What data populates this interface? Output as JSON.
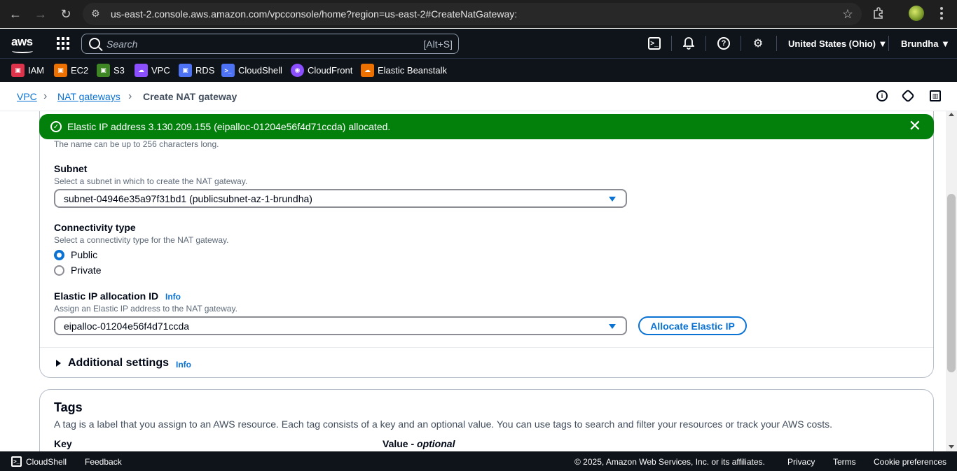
{
  "browser": {
    "url": "us-east-2.console.aws.amazon.com/vpcconsole/home?region=us-east-2#CreateNatGateway:"
  },
  "topnav": {
    "logo": "aws",
    "search_placeholder": "Search",
    "search_shortcut": "[Alt+S]",
    "region": "United States (Ohio) ▼",
    "user": "Brundha ▼"
  },
  "shortcuts": [
    {
      "label": "IAM",
      "color": "#dd344c"
    },
    {
      "label": "EC2",
      "color": "#ed7100"
    },
    {
      "label": "S3",
      "color": "#3f8624"
    },
    {
      "label": "VPC",
      "color": "#8c4fff"
    },
    {
      "label": "RDS",
      "color": "#4d72f3"
    },
    {
      "label": "CloudShell",
      "color": "#4d72f3"
    },
    {
      "label": "CloudFront",
      "color": "#8c4fff"
    },
    {
      "label": "Elastic Beanstalk",
      "color": "#ed7100"
    }
  ],
  "breadcrumb": {
    "vpc": "VPC",
    "nat": "NAT gateways",
    "current": "Create NAT gateway"
  },
  "flash": {
    "message": "Elastic IP address 3.130.209.155 (eipalloc-01204e56f4d71ccda) allocated."
  },
  "form": {
    "name_hint": "The name can be up to 256 characters long.",
    "subnet": {
      "label": "Subnet",
      "desc": "Select a subnet in which to create the NAT gateway.",
      "value": "subnet-04946e35a97f31bd1 (publicsubnet-az-1-brundha)"
    },
    "connectivity": {
      "label": "Connectivity type",
      "desc": "Select a connectivity type for the NAT gateway.",
      "public": "Public",
      "private": "Private",
      "selected": "Public"
    },
    "eip": {
      "label": "Elastic IP allocation ID",
      "info": "Info",
      "desc": "Assign an Elastic IP address to the NAT gateway.",
      "value": "eipalloc-01204e56f4d71ccda",
      "allocate_button": "Allocate Elastic IP"
    },
    "additional": {
      "label": "Additional settings",
      "info": "Info"
    }
  },
  "tags": {
    "title": "Tags",
    "desc": "A tag is a label that you assign to an AWS resource. Each tag consists of a key and an optional value. You can use tags to search and filter your resources or track your AWS costs.",
    "key_label": "Key",
    "value_label": "Value - ",
    "value_optional": "optional"
  },
  "footer": {
    "cloudshell": "CloudShell",
    "feedback": "Feedback",
    "copyright": "© 2025, Amazon Web Services, Inc. or its affiliates.",
    "privacy": "Privacy",
    "terms": "Terms",
    "cookies": "Cookie preferences"
  }
}
